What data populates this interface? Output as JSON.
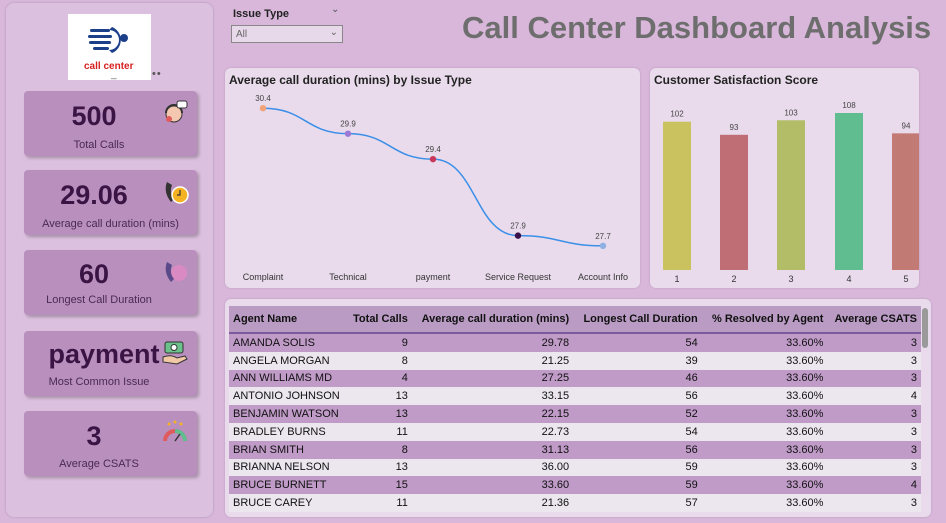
{
  "header": {
    "title": "Call Center Dashboard Analysis"
  },
  "slicer": {
    "label": "Issue Type",
    "value": "All"
  },
  "logo": {
    "text": "call center"
  },
  "kpis": [
    {
      "value": "500",
      "label": "Total Calls",
      "icon": "call-agent-icon"
    },
    {
      "value": "29.06",
      "label": "Average call duration (mins)",
      "icon": "phone-clock-icon"
    },
    {
      "value": "60",
      "label": "Longest Call Duration",
      "icon": "phone-icon"
    },
    {
      "value": "payment",
      "label": "Most Common Issue",
      "icon": "money-hand-icon"
    },
    {
      "value": "3",
      "label": "Average CSATS",
      "icon": "satisfaction-gauge-icon"
    }
  ],
  "chart_data": [
    {
      "type": "line",
      "title": "Average call duration (mins) by Issue Type",
      "categories": [
        "Complaint",
        "Technical",
        "payment",
        "Service Request",
        "Account Info"
      ],
      "values": [
        30.4,
        29.9,
        29.4,
        27.9,
        27.7
      ],
      "data_labels": [
        "30.4",
        "29.9",
        "29.4",
        "27.9",
        "27.7"
      ],
      "point_colors": [
        "#f2a37a",
        "#9b7ad6",
        "#c8385a",
        "#3b0f4a",
        "#8fb0e3"
      ],
      "line_color": "#3a8fe8",
      "grid": false
    },
    {
      "type": "bar",
      "title": "Customer Satisfaction Score",
      "categories": [
        "1",
        "2",
        "3",
        "4",
        "5"
      ],
      "values": [
        102,
        93,
        103,
        108,
        94
      ],
      "data_labels": [
        "102",
        "93",
        "103",
        "108",
        "94"
      ],
      "bar_colors": [
        "#c9c25f",
        "#bf6e76",
        "#b3bd67",
        "#5fbd8f",
        "#c27a75"
      ],
      "ylim": [
        0,
        108
      ],
      "grid": false
    }
  ],
  "table": {
    "columns": [
      "Agent Name",
      "Total Calls",
      "Average call duration (mins)",
      "Longest Call Duration",
      "% Resolved by Agent",
      "Average CSATS"
    ],
    "rows": [
      [
        "AMANDA SOLIS",
        "9",
        "29.78",
        "54",
        "33.60%",
        "3"
      ],
      [
        "ANGELA MORGAN",
        "8",
        "21.25",
        "39",
        "33.60%",
        "3"
      ],
      [
        "ANN WILLIAMS MD",
        "4",
        "27.25",
        "46",
        "33.60%",
        "3"
      ],
      [
        "ANTONIO JOHNSON",
        "13",
        "33.15",
        "56",
        "33.60%",
        "4"
      ],
      [
        "BENJAMIN WATSON",
        "13",
        "22.15",
        "52",
        "33.60%",
        "3"
      ],
      [
        "BRADLEY BURNS",
        "11",
        "22.73",
        "54",
        "33.60%",
        "3"
      ],
      [
        "BRIAN SMITH",
        "8",
        "31.13",
        "56",
        "33.60%",
        "3"
      ],
      [
        "BRIANNA NELSON",
        "13",
        "36.00",
        "59",
        "33.60%",
        "3"
      ],
      [
        "BRUCE BURNETT",
        "15",
        "33.60",
        "59",
        "33.60%",
        "4"
      ],
      [
        "BRUCE CAREY",
        "11",
        "21.36",
        "57",
        "33.60%",
        "3"
      ]
    ]
  }
}
